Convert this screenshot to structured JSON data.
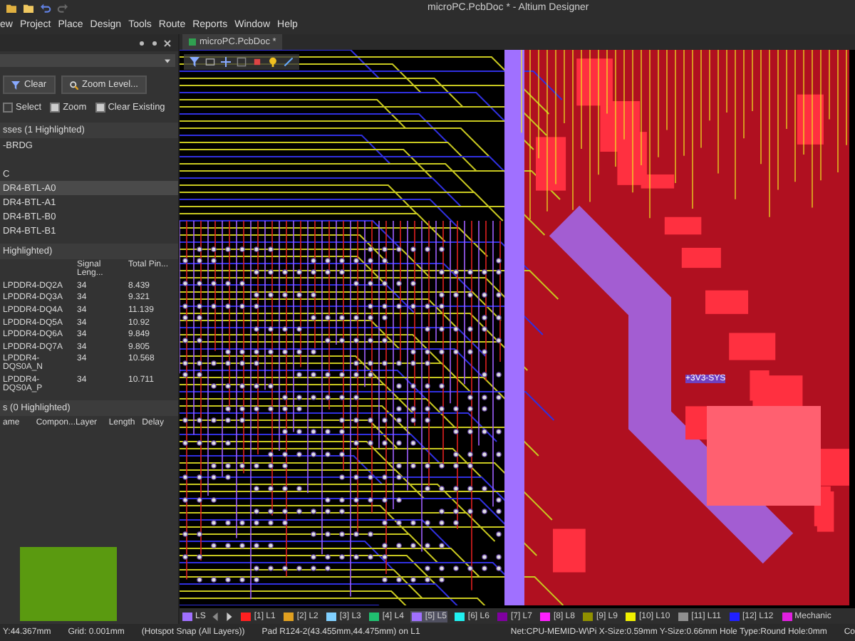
{
  "window": {
    "title": "microPC.PcbDoc * - Altium Designer"
  },
  "menu": [
    "ew",
    "Project",
    "Place",
    "Design",
    "Tools",
    "Route",
    "Reports",
    "Window",
    "Help"
  ],
  "panel": {
    "buttons": [
      "Clear",
      "Zoom Level..."
    ],
    "options": [
      {
        "label": "Select",
        "checked": false
      },
      {
        "label": "Zoom",
        "checked": true
      },
      {
        "label": "Clear Existing",
        "checked": true
      }
    ],
    "classes_header": "sses (1 Highlighted)",
    "class_items": [
      {
        "label": "-BRDG",
        "selected": false
      }
    ],
    "group_label": "C",
    "components": [
      {
        "label": "DR4-BTL-A0",
        "selected": true
      },
      {
        "label": "DR4-BTL-A1",
        "selected": false
      },
      {
        "label": "DR4-BTL-B0",
        "selected": false
      },
      {
        "label": "DR4-BTL-B1",
        "selected": false
      }
    ],
    "nets_header": "Highlighted)",
    "net_columns": [
      "",
      "Signal Leng...",
      "Total Pin..."
    ],
    "net_rows": [
      [
        "LPDDR4-DQ2A",
        "34",
        "8.439"
      ],
      [
        "LPDDR4-DQ3A",
        "34",
        "9.321"
      ],
      [
        "LPDDR4-DQ4A",
        "34",
        "11.139"
      ],
      [
        "LPDDR4-DQ5A",
        "34",
        "10.92"
      ],
      [
        "LPDDR4-DQ6A",
        "34",
        "9.849"
      ],
      [
        "LPDDR4-DQ7A",
        "34",
        "9.805"
      ],
      [
        "LPDDR4-DQS0A_N",
        "34",
        "10.568"
      ],
      [
        "LPDDR4-DQS0A_P",
        "34",
        "10.711"
      ]
    ],
    "primitives_header": "s (0 Highlighted)",
    "primitive_columns": [
      "ame",
      "Compon...",
      "Layer",
      "Length",
      "Delay"
    ]
  },
  "document_tab": {
    "label": "microPC.PcbDoc *",
    "selected": true
  },
  "canvas_labels": [
    "+3V3-SYS"
  ],
  "current_layer": {
    "label": "LS",
    "color": "#a070ff"
  },
  "layers": [
    {
      "label": "[1] L1",
      "color": "#ff2020",
      "selected": false
    },
    {
      "label": "[2] L2",
      "color": "#e0a020",
      "selected": false
    },
    {
      "label": "[3] L3",
      "color": "#80d0ff",
      "selected": false
    },
    {
      "label": "[4] L4",
      "color": "#20c070",
      "selected": false
    },
    {
      "label": "[5] L5",
      "color": "#a070ff",
      "selected": true
    },
    {
      "label": "[6] L6",
      "color": "#20f0f0",
      "selected": false
    },
    {
      "label": "[7] L7",
      "color": "#8000a0",
      "selected": false
    },
    {
      "label": "[8] L8",
      "color": "#ff20ff",
      "selected": false
    },
    {
      "label": "[9] L9",
      "color": "#909000",
      "selected": false
    },
    {
      "label": "[10] L10",
      "color": "#f0f000",
      "selected": false
    },
    {
      "label": "[11] L11",
      "color": "#909090",
      "selected": false
    },
    {
      "label": "[12] L12",
      "color": "#2020ff",
      "selected": false
    },
    {
      "label": "Mechanic",
      "color": "#e020e0",
      "selected": false
    }
  ],
  "status_bar": [
    "Y:44.367mm",
    "Grid: 0.001mm",
    "(Hotspot Snap (All Layers))",
    "Pad R124-2(43.455mm,44.475mm) on L1",
    "Net:CPU-MEMID-W\\Pi X-Size:0.59mm Y-Size:0.66mm Hole Type:Round Hole:0mm",
    "Co"
  ]
}
